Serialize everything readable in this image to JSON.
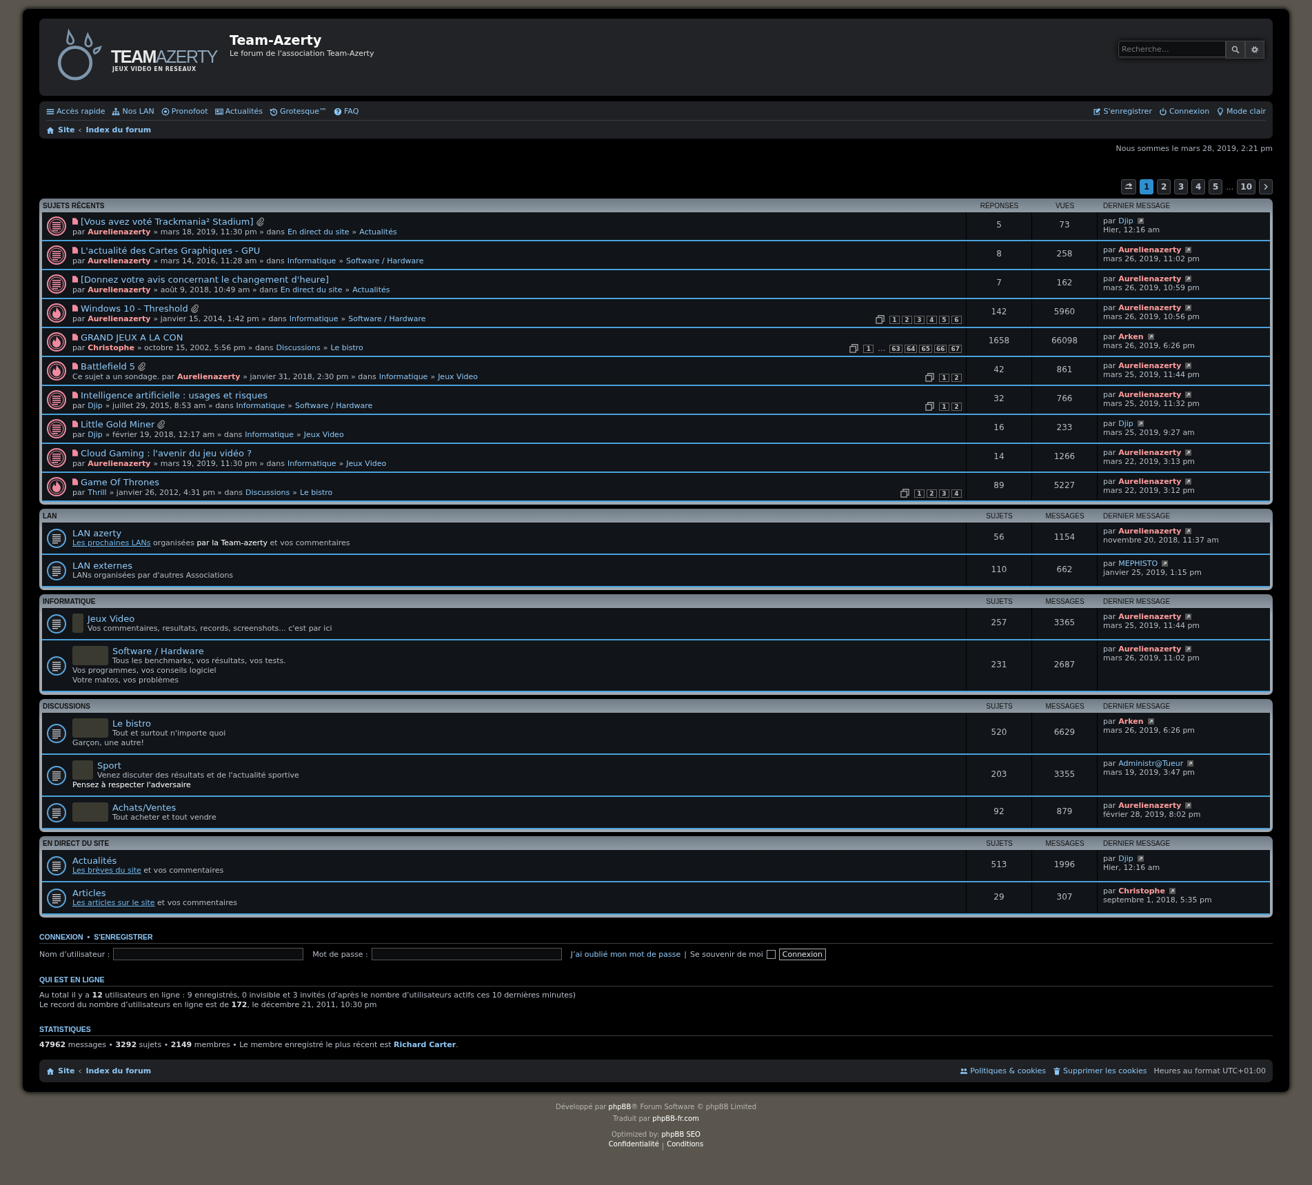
{
  "header": {
    "logo": {
      "word1": "TEAM",
      "word2": "AZERTY",
      "tagline": "JEUX VIDEO EN RESEAUX"
    },
    "title": "Team-Azerty",
    "description": "Le forum de l'association Team-Azerty",
    "search": {
      "placeholder": "Recherche…"
    }
  },
  "nav": {
    "left": [
      {
        "label": "Accès rapide"
      },
      {
        "label": "Nos LAN"
      },
      {
        "label": "Pronofoot"
      },
      {
        "label": "Actualités"
      },
      {
        "label": "Grotesque™"
      },
      {
        "label": "FAQ"
      }
    ],
    "right": [
      {
        "label": "S'enregistrer"
      },
      {
        "label": "Connexion"
      },
      {
        "label": "Mode clair"
      }
    ],
    "breadcrumbs": [
      "Site",
      "Index du forum"
    ]
  },
  "current_time": "Nous sommes le mars 28, 2019, 2:21 pm",
  "pagination": {
    "pages": [
      {
        "label": "1",
        "selected": true
      },
      {
        "label": "2",
        "selected": false
      },
      {
        "label": "3",
        "selected": false
      },
      {
        "label": "4",
        "selected": false
      },
      {
        "label": "5",
        "selected": false
      }
    ],
    "ellipsis": "…",
    "last_page": {
      "label": "10",
      "selected": false
    }
  },
  "recent": {
    "title": "SUJETS RÉCENTS",
    "columns": [
      "RÉPONSES",
      "VUES",
      "DERNIER MESSAGE"
    ],
    "rows": [
      {
        "kind": "normal",
        "title": "[Vous avez voté Trackmania² Stadium]",
        "attachment": true,
        "meta": [
          {
            "kind": "text",
            "text": "par"
          },
          {
            "kind": "team",
            "text": "Aurelienazerty"
          },
          {
            "kind": "text",
            "text": "» mars 18, 2019, 11:30 pm » dans"
          },
          {
            "kind": "link",
            "text": "En direct du site"
          },
          {
            "kind": "text",
            "text": "»"
          },
          {
            "kind": "link",
            "text": "Actualités"
          }
        ],
        "pages": [],
        "replies": "5",
        "views": "73",
        "last_by": "par",
        "last_author": {
          "name": "Djip",
          "kind": "member"
        },
        "last_date": "Hier, 12:16 am"
      },
      {
        "kind": "normal",
        "title": "L'actualité des Cartes Graphiques - GPU",
        "attachment": false,
        "meta": [
          {
            "kind": "text",
            "text": "par"
          },
          {
            "kind": "team",
            "text": "Aurelienazerty"
          },
          {
            "kind": "text",
            "text": "» mars 14, 2016, 11:28 am » dans"
          },
          {
            "kind": "link",
            "text": "Informatique"
          },
          {
            "kind": "text",
            "text": "»"
          },
          {
            "kind": "link",
            "text": "Software / Hardware"
          }
        ],
        "pages": [],
        "replies": "8",
        "views": "258",
        "last_by": "par",
        "last_author": {
          "name": "Aurelienazerty",
          "kind": "team"
        },
        "last_date": "mars 26, 2019, 11:02 pm"
      },
      {
        "kind": "normal",
        "title": "[Donnez votre avis concernant le changement d'heure]",
        "attachment": false,
        "meta": [
          {
            "kind": "text",
            "text": "par"
          },
          {
            "kind": "team",
            "text": "Aurelienazerty"
          },
          {
            "kind": "text",
            "text": "» août 9, 2018, 10:49 am » dans"
          },
          {
            "kind": "link",
            "text": "En direct du site"
          },
          {
            "kind": "text",
            "text": "»"
          },
          {
            "kind": "link",
            "text": "Actualités"
          }
        ],
        "pages": [],
        "replies": "7",
        "views": "162",
        "last_by": "par",
        "last_author": {
          "name": "Aurelienazerty",
          "kind": "team"
        },
        "last_date": "mars 26, 2019, 10:59 pm"
      },
      {
        "kind": "hot",
        "title": "Windows 10 - Threshold",
        "attachment": true,
        "meta": [
          {
            "kind": "text",
            "text": "par"
          },
          {
            "kind": "team",
            "text": "Aurelienazerty"
          },
          {
            "kind": "text",
            "text": "» janvier 15, 2014, 1:42 pm » dans"
          },
          {
            "kind": "link",
            "text": "Informatique"
          },
          {
            "kind": "text",
            "text": "»"
          },
          {
            "kind": "link",
            "text": "Software / Hardware"
          }
        ],
        "pages": [
          "1",
          "2",
          "3",
          "4",
          "5",
          "6"
        ],
        "replies": "142",
        "views": "5960",
        "last_by": "par",
        "last_author": {
          "name": "Aurelienazerty",
          "kind": "team"
        },
        "last_date": "mars 26, 2019, 10:56 pm"
      },
      {
        "kind": "hot",
        "title": "GRAND JEUX A LA CON",
        "attachment": false,
        "meta": [
          {
            "kind": "text",
            "text": "par"
          },
          {
            "kind": "team",
            "text": "Christophe"
          },
          {
            "kind": "text",
            "text": "» octobre 15, 2002, 5:56 pm » dans"
          },
          {
            "kind": "link",
            "text": "Discussions"
          },
          {
            "kind": "text",
            "text": "»"
          },
          {
            "kind": "link",
            "text": "Le bistro"
          }
        ],
        "pages": [
          "1",
          "…",
          "63",
          "64",
          "65",
          "66",
          "67"
        ],
        "replies": "1658",
        "views": "66098",
        "last_by": "par",
        "last_author": {
          "name": "Arken",
          "kind": "team"
        },
        "last_date": "mars 26, 2019, 6:26 pm"
      },
      {
        "kind": "hot",
        "title": "Battlefield 5",
        "attachment": true,
        "meta": [
          {
            "kind": "text",
            "text": "Ce sujet a un sondage. par"
          },
          {
            "kind": "team",
            "text": "Aurelienazerty"
          },
          {
            "kind": "text",
            "text": "» janvier 31, 2018, 2:30 pm » dans"
          },
          {
            "kind": "link",
            "text": "Informatique"
          },
          {
            "kind": "text",
            "text": "»"
          },
          {
            "kind": "link",
            "text": "Jeux Video"
          }
        ],
        "pages": [
          "1",
          "2"
        ],
        "replies": "42",
        "views": "861",
        "last_by": "par",
        "last_author": {
          "name": "Aurelienazerty",
          "kind": "team"
        },
        "last_date": "mars 25, 2019, 11:44 pm"
      },
      {
        "kind": "normal",
        "title": "Intelligence artificielle : usages et risques",
        "attachment": false,
        "meta": [
          {
            "kind": "text",
            "text": "par"
          },
          {
            "kind": "member",
            "text": "Djip"
          },
          {
            "kind": "text",
            "text": "» juillet 29, 2015, 8:53 am » dans"
          },
          {
            "kind": "link",
            "text": "Informatique"
          },
          {
            "kind": "text",
            "text": "»"
          },
          {
            "kind": "link",
            "text": "Software / Hardware"
          }
        ],
        "pages": [
          "1",
          "2"
        ],
        "replies": "32",
        "views": "766",
        "last_by": "par",
        "last_author": {
          "name": "Aurelienazerty",
          "kind": "team"
        },
        "last_date": "mars 25, 2019, 11:32 pm"
      },
      {
        "kind": "normal",
        "title": "Little Gold Miner",
        "attachment": true,
        "meta": [
          {
            "kind": "text",
            "text": "par"
          },
          {
            "kind": "member",
            "text": "Djip"
          },
          {
            "kind": "text",
            "text": "» février 19, 2018, 12:17 am » dans"
          },
          {
            "kind": "link",
            "text": "Informatique"
          },
          {
            "kind": "text",
            "text": "»"
          },
          {
            "kind": "link",
            "text": "Jeux Video"
          }
        ],
        "pages": [],
        "replies": "16",
        "views": "233",
        "last_by": "par",
        "last_author": {
          "name": "Djip",
          "kind": "member"
        },
        "last_date": "mars 25, 2019, 9:27 am"
      },
      {
        "kind": "normal",
        "title": "Cloud Gaming : l'avenir du jeu vidéo ?",
        "attachment": false,
        "meta": [
          {
            "kind": "text",
            "text": "par"
          },
          {
            "kind": "team",
            "text": "Aurelienazerty"
          },
          {
            "kind": "text",
            "text": "» mars 19, 2019, 11:30 pm » dans"
          },
          {
            "kind": "link",
            "text": "Informatique"
          },
          {
            "kind": "text",
            "text": "»"
          },
          {
            "kind": "link",
            "text": "Jeux Video"
          }
        ],
        "pages": [],
        "replies": "14",
        "views": "1266",
        "last_by": "par",
        "last_author": {
          "name": "Aurelienazerty",
          "kind": "team"
        },
        "last_date": "mars 22, 2019, 3:13 pm"
      },
      {
        "kind": "hot",
        "title": "Game Of Thrones",
        "attachment": false,
        "meta": [
          {
            "kind": "text",
            "text": "par"
          },
          {
            "kind": "member",
            "text": "Thrill"
          },
          {
            "kind": "text",
            "text": "» janvier 26, 2012, 4:31 pm » dans"
          },
          {
            "kind": "link",
            "text": "Discussions"
          },
          {
            "kind": "text",
            "text": "»"
          },
          {
            "kind": "link",
            "text": "Le bistro"
          }
        ],
        "pages": [
          "1",
          "2",
          "3",
          "4"
        ],
        "replies": "89",
        "views": "5227",
        "last_by": "par",
        "last_author": {
          "name": "Aurelienazerty",
          "kind": "team"
        },
        "last_date": "mars 22, 2019, 3:12 pm"
      }
    ]
  },
  "categories": [
    {
      "title": "LAN",
      "columns": [
        "SUJETS",
        "MESSAGES",
        "DERNIER MESSAGE"
      ],
      "forums": [
        {
          "kind": "plain",
          "title": "LAN azerty",
          "description": [
            [
              {
                "kind": "link",
                "text": "Les prochaines LANs"
              },
              {
                "kind": "text",
                "text": " organisées "
              },
              {
                "kind": "strong",
                "text": "par la Team-azerty"
              },
              {
                "kind": "text",
                "text": " et vos commentaires"
              }
            ]
          ],
          "topics": "56",
          "posts": "1154",
          "last_by": "par",
          "last_author": {
            "name": "Aurelienazerty",
            "kind": "team"
          },
          "last_date": "novembre 20, 2018, 11:37 am"
        },
        {
          "kind": "plain",
          "title": "LAN externes",
          "description": [
            [
              {
                "kind": "text",
                "text": "LANs organisées par d'autres Associations"
              }
            ]
          ],
          "topics": "110",
          "posts": "662",
          "last_by": "par",
          "last_author": {
            "name": "MEPHISTO",
            "kind": "member"
          },
          "last_date": "janvier 25, 2019, 1:15 pm"
        }
      ]
    },
    {
      "title": "INFORMATIQUE",
      "columns": [
        "SUJETS",
        "MESSAGES",
        "DERNIER MESSAGE"
      ],
      "forums": [
        {
          "kind": "narrow",
          "title": "Jeux Video",
          "description": [
            [
              {
                "kind": "text",
                "text": "Vos commentaires, resultats, records, screenshots... c'est par ici"
              }
            ]
          ],
          "topics": "257",
          "posts": "3365",
          "last_by": "par",
          "last_author": {
            "name": "Aurelienazerty",
            "kind": "team"
          },
          "last_date": "mars 25, 2019, 11:44 pm"
        },
        {
          "kind": "wide",
          "title": "Software / Hardware",
          "description": [
            [
              {
                "kind": "text",
                "text": "Tous les benchmarks, vos résultats, vos tests."
              }
            ],
            [
              {
                "kind": "text",
                "text": "Vos programmes, vos conseils logiciel"
              }
            ],
            [
              {
                "kind": "text",
                "text": "Votre matos, vos problèmes"
              }
            ]
          ],
          "topics": "231",
          "posts": "2687",
          "last_by": "par",
          "last_author": {
            "name": "Aurelienazerty",
            "kind": "team"
          },
          "last_date": "mars 26, 2019, 11:02 pm"
        }
      ]
    },
    {
      "title": "DISCUSSIONS",
      "columns": [
        "SUJETS",
        "MESSAGES",
        "DERNIER MESSAGE"
      ],
      "forums": [
        {
          "kind": "wide",
          "title": "Le bistro",
          "description": [
            [
              {
                "kind": "text",
                "text": "Tout et surtout n'importe quoi"
              }
            ],
            [
              {
                "kind": "text",
                "text": "Garçon, une autre!"
              }
            ]
          ],
          "topics": "520",
          "posts": "6629",
          "last_by": "par",
          "last_author": {
            "name": "Arken",
            "kind": "team"
          },
          "last_date": "mars 26, 2019, 6:26 pm"
        },
        {
          "kind": "medium",
          "title": "Sport",
          "description": [
            [
              {
                "kind": "text",
                "text": "Venez discuter des résultats et de l'actualité sportive"
              }
            ],
            [
              {
                "kind": "strong",
                "text": "Pensez à respecter l'adversaire"
              }
            ]
          ],
          "topics": "203",
          "posts": "3355",
          "last_by": "par",
          "last_author": {
            "name": "Administr@Tueur",
            "kind": "member"
          },
          "last_date": "mars 19, 2019, 3:47 pm"
        },
        {
          "kind": "wide",
          "title": "Achats/Ventes",
          "description": [
            [
              {
                "kind": "text",
                "text": "Tout acheter et tout vendre"
              }
            ]
          ],
          "topics": "92",
          "posts": "879",
          "last_by": "par",
          "last_author": {
            "name": "Aurelienazerty",
            "kind": "team"
          },
          "last_date": "février 28, 2019, 8:02 pm"
        }
      ]
    },
    {
      "title": "EN DIRECT DU SITE",
      "columns": [
        "SUJETS",
        "MESSAGES",
        "DERNIER MESSAGE"
      ],
      "forums": [
        {
          "kind": "plain",
          "title": "Actualités",
          "description": [
            [
              {
                "kind": "link",
                "text": "Les brèves du site"
              },
              {
                "kind": "text",
                "text": " et vos commentaires"
              }
            ]
          ],
          "topics": "513",
          "posts": "1996",
          "last_by": "par",
          "last_author": {
            "name": "Djip",
            "kind": "member"
          },
          "last_date": "Hier, 12:16 am"
        },
        {
          "kind": "plain",
          "title": "Articles",
          "description": [
            [
              {
                "kind": "link",
                "text": "Les articles sur le site"
              },
              {
                "kind": "text",
                "text": " et vos commentaires"
              }
            ]
          ],
          "topics": "29",
          "posts": "307",
          "last_by": "par",
          "last_author": {
            "name": "Christophe",
            "kind": "team"
          },
          "last_date": "septembre 1, 2018, 5:35 pm"
        }
      ]
    }
  ],
  "login": {
    "title_links": [
      "CONNEXION",
      "S'ENREGISTRER"
    ],
    "title_sep": "•",
    "username_label": "Nom d’utilisateur :",
    "password_label": "Mot de passe :",
    "forgot": "J’ai oublié mon mot de passe",
    "sep": "|",
    "remember": "Se souvenir de moi",
    "remember_checked": false,
    "button": "Connexion"
  },
  "online": {
    "title": "QUI EST EN LIGNE",
    "lines": [
      "Au total il y a **12** utilisateurs en ligne : 9 enregistrés, 0 invisible et 3 invités (d’après le nombre d’utilisateurs actifs ces 10 dernières minutes)",
      "Le record du nombre d’utilisateurs en ligne est de **172**, le décembre 21, 2011, 10:30 pm"
    ]
  },
  "stats": {
    "title": "STATISTIQUES",
    "text": "**47962** messages • **3292** sujets • **2149** membres • Le membre enregistré le plus récent est ",
    "newest": "Richard Carter",
    "end": "."
  },
  "footer_bar": {
    "breadcrumbs": [
      "Site",
      "Index du forum"
    ],
    "links": [
      "Politiques & cookies",
      "Supprimer les cookies"
    ],
    "timezone": "Heures au format UTC+01:00"
  },
  "credits": {
    "line1_before": "Développé par ",
    "line1_link": "phpBB",
    "line1_after": "® Forum Software © phpBB Limited",
    "line2_before": "Traduit par ",
    "line2_link": "phpBB-fr.com",
    "line3_before": "Optimized by: ",
    "line3_link": "phpBB SEO",
    "links": [
      "Confidentialité",
      "Conditions"
    ],
    "sep": "|"
  }
}
